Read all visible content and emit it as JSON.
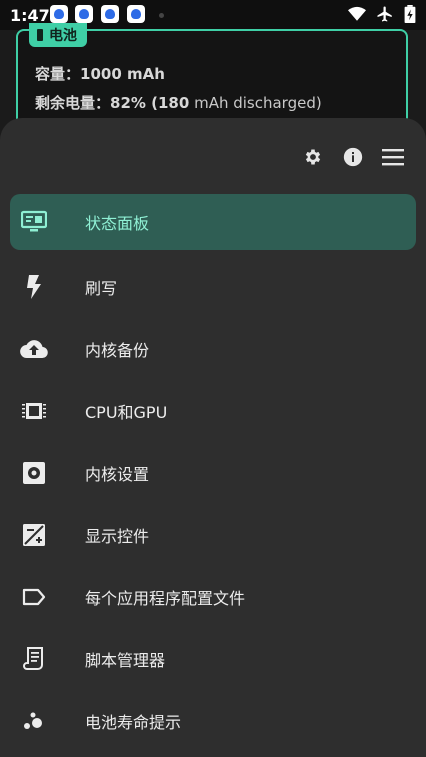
{
  "status_bar": {
    "time": "1:47",
    "app_icons": [
      "baidu-paw-icon",
      "baidu-paw-icon",
      "baidu-paw-icon",
      "baidu-paw-icon"
    ],
    "right_icons": [
      "wifi-icon",
      "airplane-icon",
      "battery-charging-icon"
    ]
  },
  "card": {
    "chip_label": "电池",
    "capacity_label": "容量：",
    "capacity_value": "1000 mAh",
    "remaining_label": "剩余电量：",
    "remaining_value": "82% (180",
    "remaining_suffix": " mAh discharged)"
  },
  "drawer": {
    "top_icons": [
      "settings-icon",
      "info-icon",
      "menu-icon"
    ],
    "items": [
      {
        "label": "状态面板",
        "icon": "dashboard-icon",
        "active": true
      },
      {
        "label": "刷写",
        "icon": "flash-icon",
        "active": false
      },
      {
        "label": "内核备份",
        "icon": "cloud-upload-icon",
        "active": false
      },
      {
        "label": "CPU和GPU",
        "icon": "chip-icon",
        "active": false
      },
      {
        "label": "内核设置",
        "icon": "settings-box-icon",
        "active": false
      },
      {
        "label": "显示控件",
        "icon": "exposure-icon",
        "active": false
      },
      {
        "label": "每个应用程序配置文件",
        "icon": "label-icon",
        "active": false
      },
      {
        "label": "脚本管理器",
        "icon": "script-icon",
        "active": false
      },
      {
        "label": "电池寿命提示",
        "icon": "bubbles-icon",
        "active": false
      }
    ]
  },
  "colors": {
    "accent": "#3fcfa6",
    "active_bg": "#2f5e54",
    "active_text": "#8ff0d4",
    "drawer_bg": "#2e2e2e"
  }
}
